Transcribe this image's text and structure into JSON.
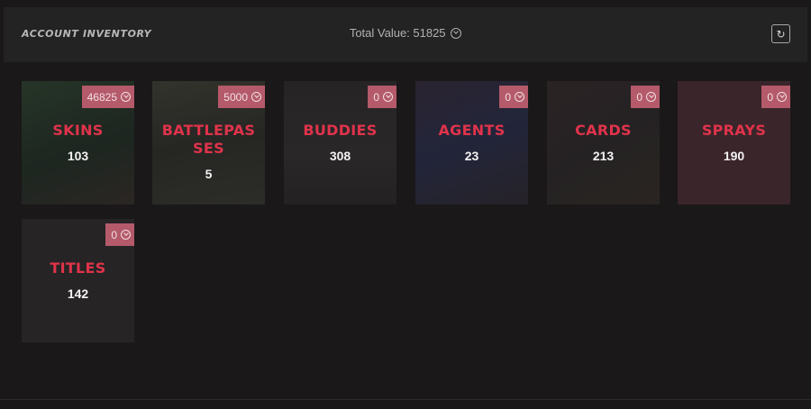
{
  "header": {
    "title": "ACCOUNT INVENTORY",
    "total_value": "Total Value: 51825",
    "currency_icon": "valorant-points-icon",
    "refresh_icon": "refresh-icon"
  },
  "cards": [
    {
      "label": "SKINS",
      "count": "103",
      "value": "46825",
      "tint": "#1f2a22"
    },
    {
      "label": "BATTLEPASSES",
      "count": "5",
      "value": "5000",
      "tint": "#2a2a26"
    },
    {
      "label": "BUDDIES",
      "count": "308",
      "value": "0",
      "tint": "#252224"
    },
    {
      "label": "AGENTS",
      "count": "23",
      "value": "0",
      "tint": "#22222c"
    },
    {
      "label": "CARDS",
      "count": "213",
      "value": "0",
      "tint": "#272223"
    },
    {
      "label": "SPRAYS",
      "count": "190",
      "value": "0",
      "tint": "#3a2229"
    },
    {
      "label": "TITLES",
      "count": "142",
      "value": "0",
      "tint": "#252424"
    }
  ]
}
